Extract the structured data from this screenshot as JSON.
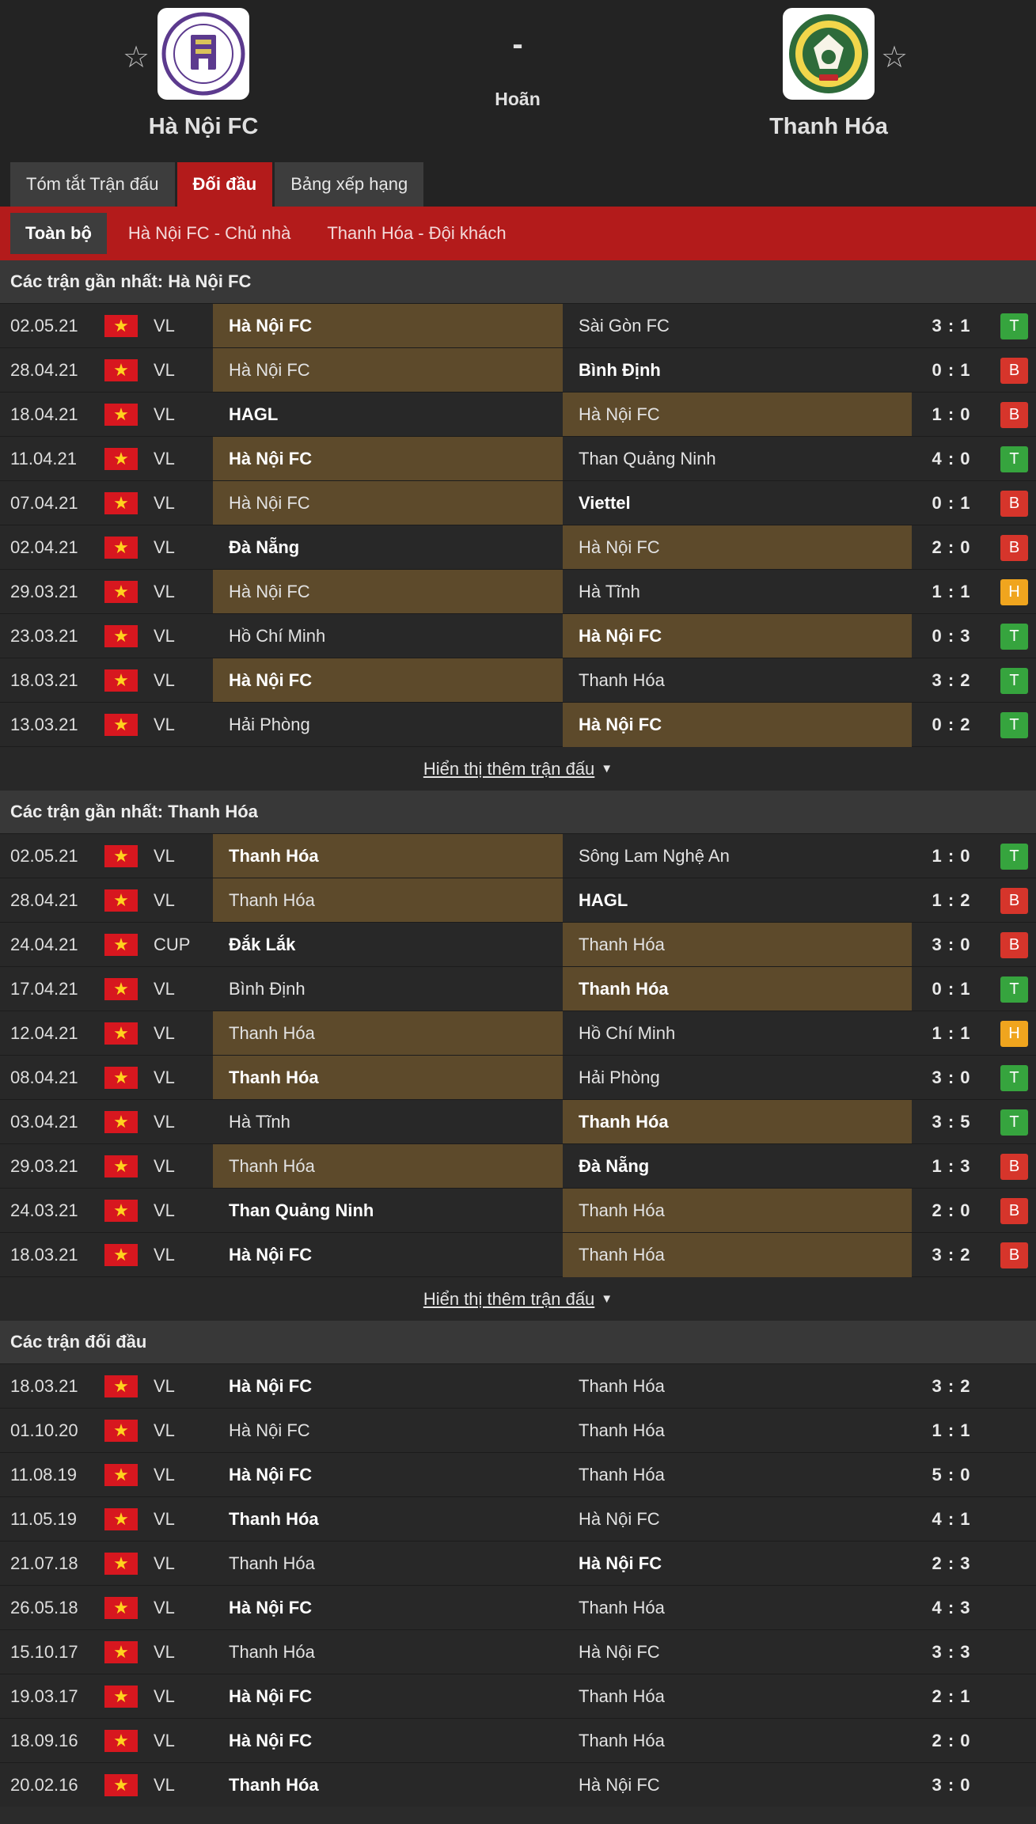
{
  "match": {
    "home_team": "Hà Nội FC",
    "away_team": "Thanh Hóa",
    "score": "-",
    "status": "Hoãn"
  },
  "icons": {
    "favorite": "star-icon",
    "flag": "vietnam-flag-icon",
    "dropdown": "caret-down-icon"
  },
  "colors": {
    "accent": "#b31b1b",
    "highlight": "#5d4a2b",
    "win": "#36a43e",
    "loss": "#d6352b",
    "draw": "#f0a51e"
  },
  "tabs": [
    "Tóm tắt Trận đấu",
    "Đối đầu",
    "Bảng xếp hạng"
  ],
  "subtabs": [
    "Toàn bộ",
    "Hà Nội FC - Chủ nhà",
    "Thanh Hóa - Đội khách"
  ],
  "show_more_label": "Hiển thị thêm trận đấu",
  "sections": [
    {
      "title": "Các trận gần nhất: Hà Nội FC",
      "show_more": true,
      "rows": [
        {
          "date": "02.05.21",
          "comp": "VL",
          "home": "Hà Nội FC",
          "away": "Sài Gòn FC",
          "score": "3 : 1",
          "winner": "home",
          "focus": "home",
          "result": "T"
        },
        {
          "date": "28.04.21",
          "comp": "VL",
          "home": "Hà Nội FC",
          "away": "Bình Định",
          "score": "0 : 1",
          "winner": "away",
          "focus": "home",
          "result": "B"
        },
        {
          "date": "18.04.21",
          "comp": "VL",
          "home": "HAGL",
          "away": "Hà Nội FC",
          "score": "1 : 0",
          "winner": "home",
          "focus": "away",
          "result": "B"
        },
        {
          "date": "11.04.21",
          "comp": "VL",
          "home": "Hà Nội FC",
          "away": "Than Quảng Ninh",
          "score": "4 : 0",
          "winner": "home",
          "focus": "home",
          "result": "T"
        },
        {
          "date": "07.04.21",
          "comp": "VL",
          "home": "Hà Nội FC",
          "away": "Viettel",
          "score": "0 : 1",
          "winner": "away",
          "focus": "home",
          "result": "B"
        },
        {
          "date": "02.04.21",
          "comp": "VL",
          "home": "Đà Nẵng",
          "away": "Hà Nội FC",
          "score": "2 : 0",
          "winner": "home",
          "focus": "away",
          "result": "B"
        },
        {
          "date": "29.03.21",
          "comp": "VL",
          "home": "Hà Nội FC",
          "away": "Hà Tĩnh",
          "score": "1 : 1",
          "winner": "none",
          "focus": "home",
          "result": "H"
        },
        {
          "date": "23.03.21",
          "comp": "VL",
          "home": "Hồ Chí Minh",
          "away": "Hà Nội FC",
          "score": "0 : 3",
          "winner": "away",
          "focus": "away",
          "result": "T"
        },
        {
          "date": "18.03.21",
          "comp": "VL",
          "home": "Hà Nội FC",
          "away": "Thanh Hóa",
          "score": "3 : 2",
          "winner": "home",
          "focus": "home",
          "result": "T"
        },
        {
          "date": "13.03.21",
          "comp": "VL",
          "home": "Hải Phòng",
          "away": "Hà Nội FC",
          "score": "0 : 2",
          "winner": "away",
          "focus": "away",
          "result": "T"
        }
      ]
    },
    {
      "title": "Các trận gần nhất: Thanh Hóa",
      "show_more": true,
      "rows": [
        {
          "date": "02.05.21",
          "comp": "VL",
          "home": "Thanh Hóa",
          "away": "Sông Lam Nghệ An",
          "score": "1 : 0",
          "winner": "home",
          "focus": "home",
          "result": "T"
        },
        {
          "date": "28.04.21",
          "comp": "VL",
          "home": "Thanh Hóa",
          "away": "HAGL",
          "score": "1 : 2",
          "winner": "away",
          "focus": "home",
          "result": "B"
        },
        {
          "date": "24.04.21",
          "comp": "CUP",
          "home": "Đắk Lắk",
          "away": "Thanh Hóa",
          "score": "3 : 0",
          "winner": "home",
          "focus": "away",
          "result": "B"
        },
        {
          "date": "17.04.21",
          "comp": "VL",
          "home": "Bình Định",
          "away": "Thanh Hóa",
          "score": "0 : 1",
          "winner": "away",
          "focus": "away",
          "result": "T"
        },
        {
          "date": "12.04.21",
          "comp": "VL",
          "home": "Thanh Hóa",
          "away": "Hồ Chí Minh",
          "score": "1 : 1",
          "winner": "none",
          "focus": "home",
          "result": "H"
        },
        {
          "date": "08.04.21",
          "comp": "VL",
          "home": "Thanh Hóa",
          "away": "Hải Phòng",
          "score": "3 : 0",
          "winner": "home",
          "focus": "home",
          "result": "T"
        },
        {
          "date": "03.04.21",
          "comp": "VL",
          "home": "Hà Tĩnh",
          "away": "Thanh Hóa",
          "score": "3 : 5",
          "winner": "away",
          "focus": "away",
          "result": "T"
        },
        {
          "date": "29.03.21",
          "comp": "VL",
          "home": "Thanh Hóa",
          "away": "Đà Nẵng",
          "score": "1 : 3",
          "winner": "away",
          "focus": "home",
          "result": "B"
        },
        {
          "date": "24.03.21",
          "comp": "VL",
          "home": "Than Quảng Ninh",
          "away": "Thanh Hóa",
          "score": "2 : 0",
          "winner": "home",
          "focus": "away",
          "result": "B"
        },
        {
          "date": "18.03.21",
          "comp": "VL",
          "home": "Hà Nội FC",
          "away": "Thanh Hóa",
          "score": "3 : 2",
          "winner": "home",
          "focus": "away",
          "result": "B"
        }
      ]
    },
    {
      "title": "Các trận đối đầu",
      "show_more": false,
      "rows": [
        {
          "date": "18.03.21",
          "comp": "VL",
          "home": "Hà Nội FC",
          "away": "Thanh Hóa",
          "score": "3 : 2",
          "winner": "home",
          "focus": "none",
          "result": ""
        },
        {
          "date": "01.10.20",
          "comp": "VL",
          "home": "Hà Nội FC",
          "away": "Thanh Hóa",
          "score": "1 : 1",
          "winner": "none",
          "focus": "none",
          "result": ""
        },
        {
          "date": "11.08.19",
          "comp": "VL",
          "home": "Hà Nội FC",
          "away": "Thanh Hóa",
          "score": "5 : 0",
          "winner": "home",
          "focus": "none",
          "result": ""
        },
        {
          "date": "11.05.19",
          "comp": "VL",
          "home": "Thanh Hóa",
          "away": "Hà Nội FC",
          "score": "4 : 1",
          "winner": "home",
          "focus": "none",
          "result": ""
        },
        {
          "date": "21.07.18",
          "comp": "VL",
          "home": "Thanh Hóa",
          "away": "Hà Nội FC",
          "score": "2 : 3",
          "winner": "away",
          "focus": "none",
          "result": ""
        },
        {
          "date": "26.05.18",
          "comp": "VL",
          "home": "Hà Nội FC",
          "away": "Thanh Hóa",
          "score": "4 : 3",
          "winner": "home",
          "focus": "none",
          "result": ""
        },
        {
          "date": "15.10.17",
          "comp": "VL",
          "home": "Thanh Hóa",
          "away": "Hà Nội FC",
          "score": "3 : 3",
          "winner": "none",
          "focus": "none",
          "result": ""
        },
        {
          "date": "19.03.17",
          "comp": "VL",
          "home": "Hà Nội FC",
          "away": "Thanh Hóa",
          "score": "2 : 1",
          "winner": "home",
          "focus": "none",
          "result": ""
        },
        {
          "date": "18.09.16",
          "comp": "VL",
          "home": "Hà Nội FC",
          "away": "Thanh Hóa",
          "score": "2 : 0",
          "winner": "home",
          "focus": "none",
          "result": ""
        },
        {
          "date": "20.02.16",
          "comp": "VL",
          "home": "Thanh Hóa",
          "away": "Hà Nội FC",
          "score": "3 : 0",
          "winner": "home",
          "focus": "none",
          "result": ""
        }
      ]
    }
  ]
}
